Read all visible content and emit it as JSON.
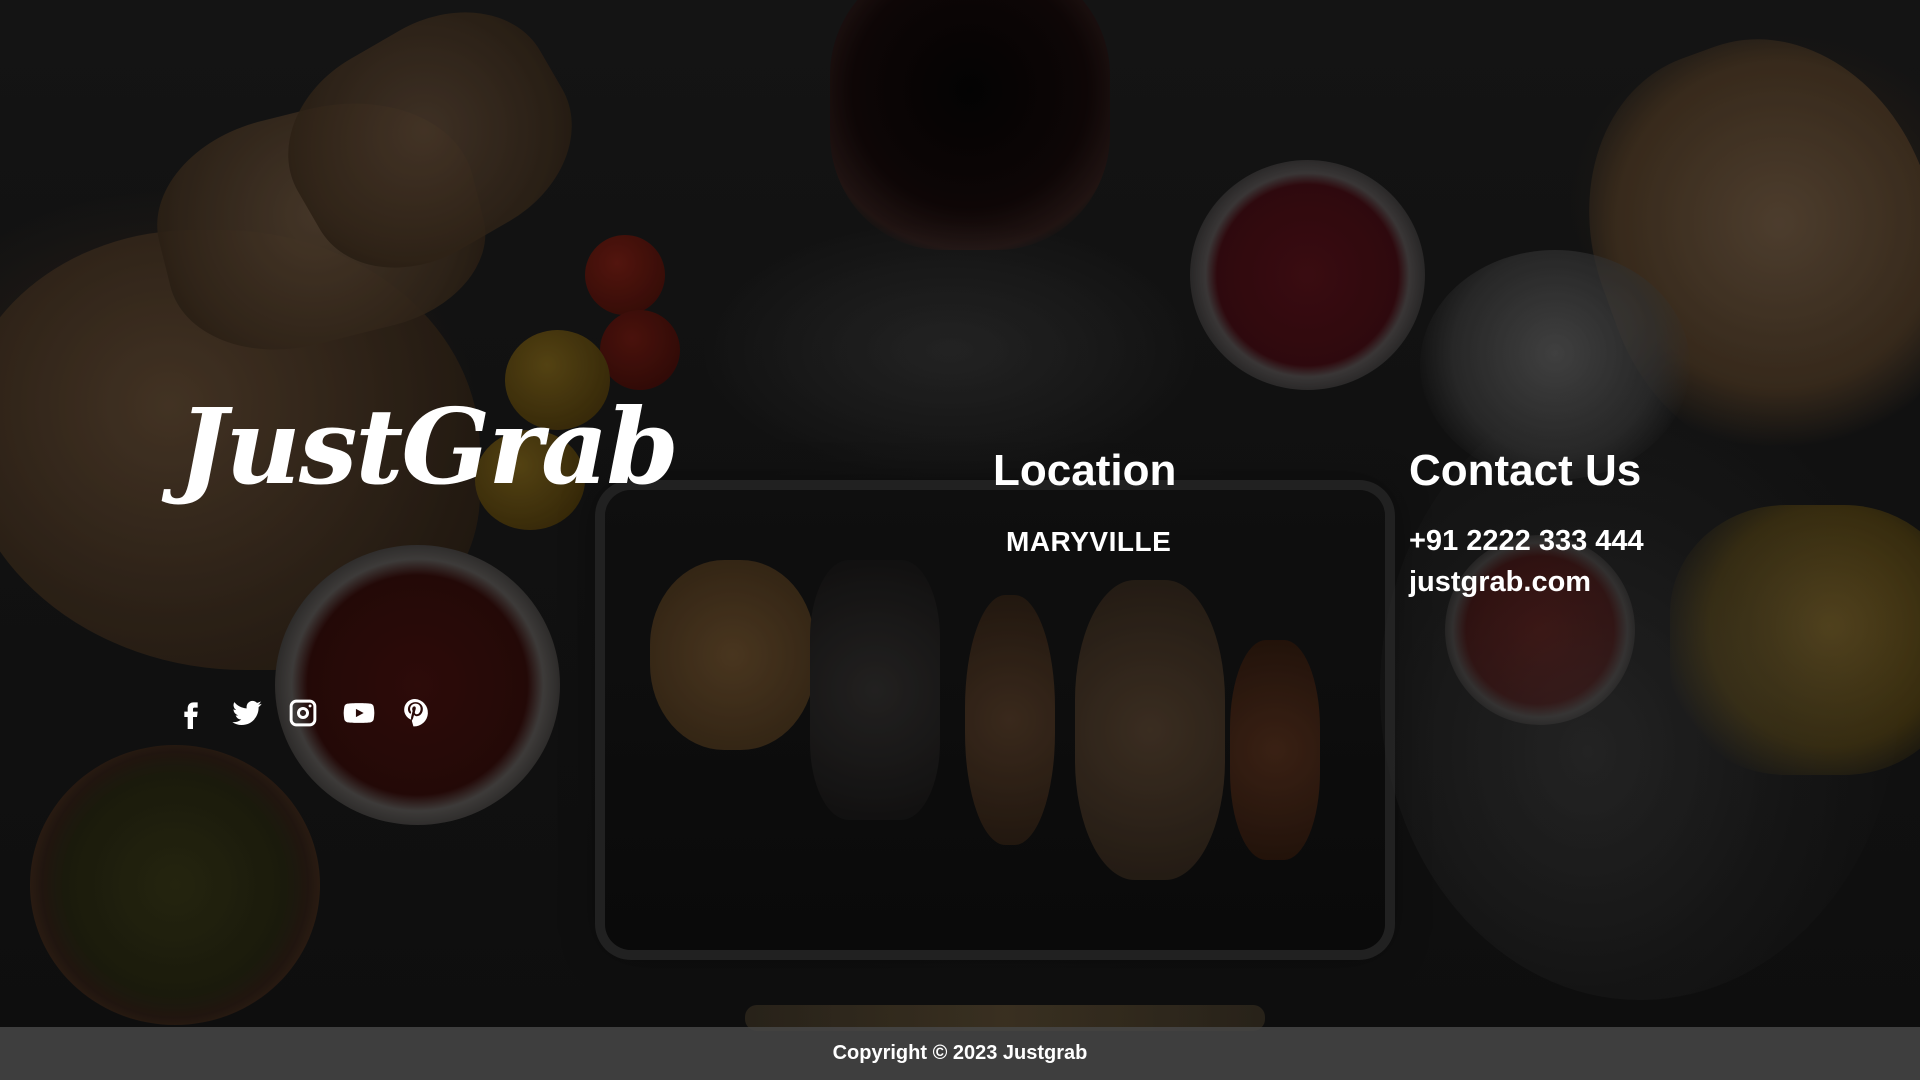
{
  "brand": {
    "logo_text": "JustGrab"
  },
  "location": {
    "title": "Location",
    "city": "MARYVILLE"
  },
  "contact": {
    "title": "Contact Us",
    "phone": "+91 2222 333 444",
    "website": "justgrab.com"
  },
  "social": {
    "icons": [
      "facebook-icon",
      "twitter-icon",
      "instagram-icon",
      "youtube-icon",
      "pinterest-icon"
    ]
  },
  "footer": {
    "copyright": "Copyright © 2023 Justgrab"
  },
  "colors": {
    "text": "#ffffff",
    "background": "#161616",
    "footer_bar": "#464646"
  }
}
